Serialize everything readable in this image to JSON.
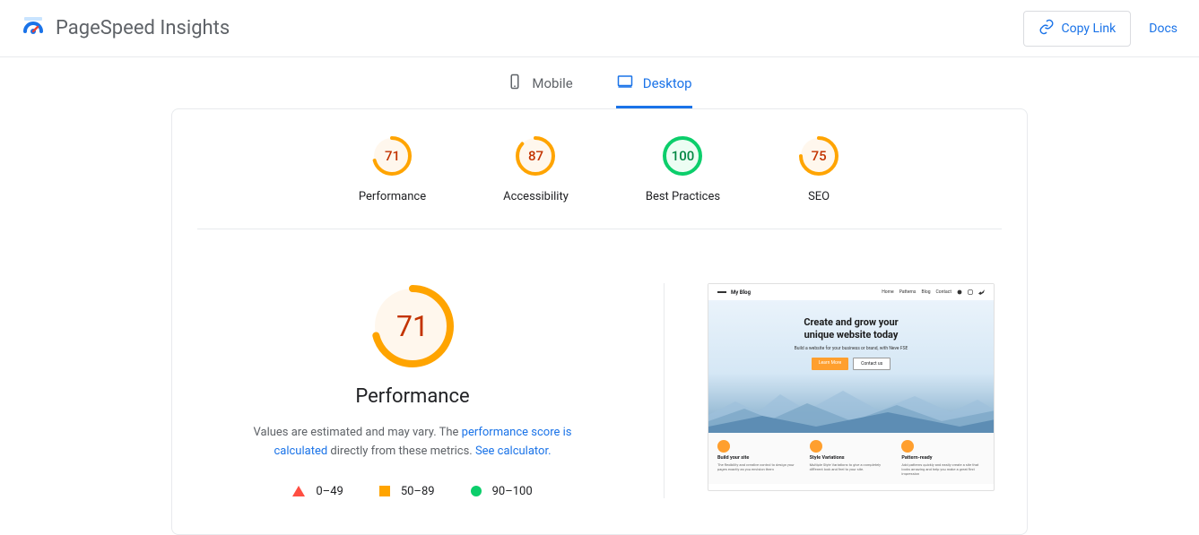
{
  "header": {
    "title": "PageSpeed Insights",
    "copy_link": "Copy Link",
    "docs": "Docs"
  },
  "tabs": {
    "mobile": "Mobile",
    "desktop": "Desktop",
    "active": "desktop"
  },
  "scores": [
    {
      "value": 71,
      "label": "Performance",
      "color": "#fa3"
    },
    {
      "value": 87,
      "label": "Accessibility",
      "color": "#fa3"
    },
    {
      "value": 100,
      "label": "Best Practices",
      "color": "#0c6"
    },
    {
      "value": 75,
      "label": "SEO",
      "color": "#fa3"
    }
  ],
  "detail": {
    "score": 71,
    "title": "Performance",
    "desc_prefix": "Values are estimated and may vary. The ",
    "desc_link1": "performance score is calculated",
    "desc_middle": " directly from these metrics. ",
    "desc_link2": "See calculator.",
    "legend": {
      "bad": "0–49",
      "avg": "50–89",
      "good": "90–100"
    }
  },
  "screenshot": {
    "site_title": "My Blog",
    "nav": [
      "Home",
      "Patterns",
      "Blog",
      "Contact"
    ],
    "hero_line1": "Create and grow your",
    "hero_line2": "unique website today",
    "hero_sub": "Build a website for your business or brand, with Neve FSE",
    "btn1": "Learn More",
    "btn2": "Contact us",
    "cols": [
      {
        "title": "Build your site",
        "desc": "The flexibility and creative control to design your pages exactly as you envision them"
      },
      {
        "title": "Style Variations",
        "desc": "Multiple Style Variations to give a completely different look and feel to your site."
      },
      {
        "title": "Pattern-ready",
        "desc": "Add patterns quickly and easily create a site that looks amazing and help you make a great first impression"
      }
    ]
  }
}
